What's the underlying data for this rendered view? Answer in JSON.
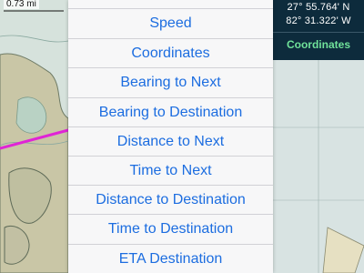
{
  "map": {
    "scale_label": "0.73 mi"
  },
  "coordinate_panel": {
    "latitude": "27° 55.764' N",
    "longitude": "82° 31.322' W",
    "label": "Coordinates"
  },
  "menu": {
    "items": [
      {
        "label": "Speed"
      },
      {
        "label": "Coordinates"
      },
      {
        "label": "Bearing to Next"
      },
      {
        "label": "Bearing to Destination"
      },
      {
        "label": "Distance to Next"
      },
      {
        "label": "Time to Next"
      },
      {
        "label": "Distance to Destination"
      },
      {
        "label": "Time to Destination"
      },
      {
        "label": "ETA Destination"
      }
    ]
  },
  "colors": {
    "menu_text": "#1c6de0",
    "panel_bg": "#0d2b3c",
    "panel_accent": "#70e29a",
    "route_line": "#e024d6"
  }
}
